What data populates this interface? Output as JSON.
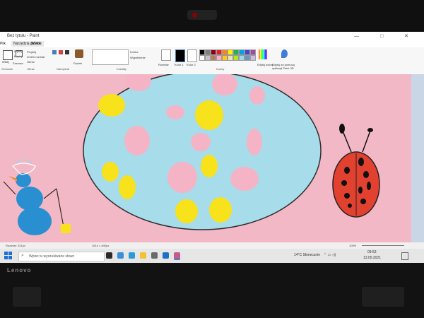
{
  "window": {
    "title": "Bez tytułu - Paint",
    "controls": [
      "—",
      "□",
      "✕"
    ]
  },
  "ribbon": {
    "tabs": [
      "Plik",
      "Narzędzia główne",
      "Widok"
    ],
    "groups": [
      "Schowek",
      "Obraz",
      "Narzędzia",
      "Kształty",
      "Kolory"
    ],
    "clipboard": {
      "paste_label": "Wklej",
      "cut_label": "Wytnij",
      "copy_label": "Kopiuj"
    },
    "image": {
      "select_label": "Zaznacz",
      "crop_label": "Przytnij",
      "resize_label": "Zmień rozmiar",
      "rotate_label": "Obróć"
    },
    "tools_brushes": "Pędzle",
    "shapes": {
      "outline_label": "Kontur",
      "fill_label": "Wypełnienie"
    },
    "size_label": "Rozmiar",
    "color1_label": "Kolor 1",
    "color2_label": "Kolor 2",
    "edit_colors_label": "Edytuj kolory",
    "paint3d_label": "Edytuj za pomocą aplikacji Paint 3D",
    "palette": [
      "#000000",
      "#7f7f7f",
      "#880015",
      "#ed1c24",
      "#ff7f27",
      "#fff200",
      "#22b14c",
      "#00a2e8",
      "#3f48cc",
      "#a349a4",
      "#ffffff",
      "#c3c3c3",
      "#b97a57",
      "#ffaec9",
      "#ffc90e",
      "#efe4b0",
      "#b5e61d",
      "#99d9ea",
      "#7092be",
      "#c8bfe7"
    ]
  },
  "status": {
    "size_text": "Rozmiar: 321px",
    "dims_text": "1614 × 840px",
    "zoom": "100%"
  },
  "taskbar": {
    "search_placeholder": "Wpisz tu wyszukiwane słowo",
    "weather": "14°C Słonecznie",
    "time": "09:53",
    "date": "13.05.2021"
  },
  "device": {
    "brand": "Lenovo"
  },
  "colors": {
    "canvas_pink": "#f2b8c6",
    "egg_blue": "#a7dcea",
    "dot_yellow": "#f7e21b",
    "dot_pink": "#f4b4c6",
    "ladybug_red": "#e2412f",
    "snowman_blue": "#2a8fd0"
  }
}
